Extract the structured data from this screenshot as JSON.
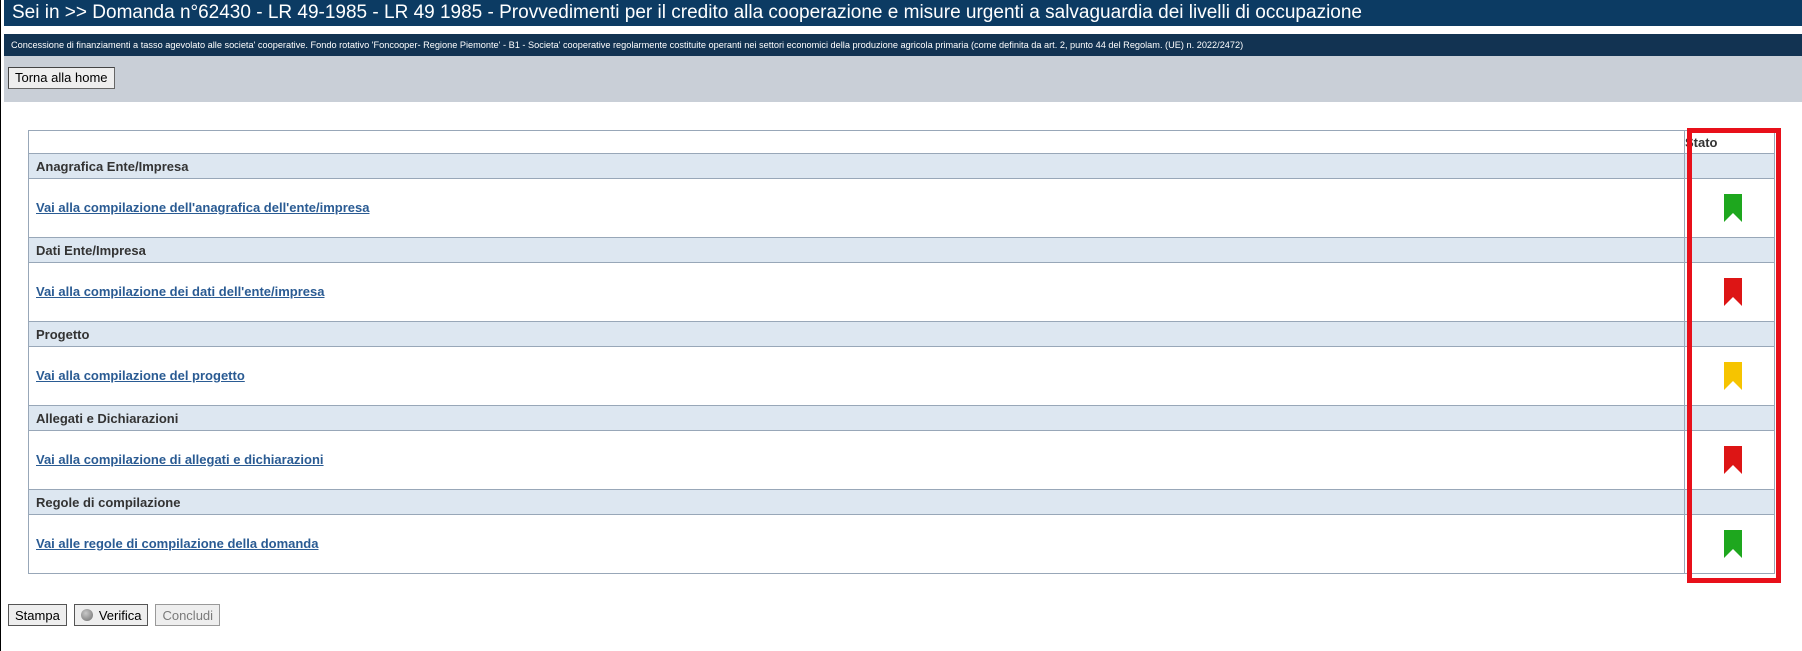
{
  "header": {
    "title": "Sei in >> Domanda n°62430 - LR 49-1985 - LR 49 1985 - Provvedimenti per il credito alla cooperazione e misure urgenti a salvaguardia dei livelli di occupazione",
    "subtitle": "Concessione di finanziamenti a tasso agevolato alle societa' cooperative. Fondo rotativo 'Foncooper- Regione Piemonte' - B1 - Societa' cooperative regolarmente costituite operanti nei settori economici della produzione agricola primaria (come definita da art. 2, punto 44 del Regolam. (UE) n. 2022/2472)"
  },
  "toolbar": {
    "home_label": "Torna alla home"
  },
  "table": {
    "stato_header": "Stato",
    "sections": [
      {
        "title": "Anagrafica Ente/Impresa",
        "link": "Vai alla compilazione dell'anagrafica dell'ente/impresa",
        "status": "green-flag-icon",
        "color": "#1ea71e"
      },
      {
        "title": "Dati Ente/Impresa",
        "link": "Vai alla compilazione dei dati dell'ente/impresa",
        "status": "red-flag-icon",
        "color": "#dd1515"
      },
      {
        "title": "Progetto",
        "link": "Vai alla compilazione del progetto",
        "status": "yellow-flag-icon",
        "color": "#f6c400"
      },
      {
        "title": "Allegati e Dichiarazioni",
        "link": "Vai alla compilazione di allegati e dichiarazioni",
        "status": "red-flag-icon",
        "color": "#dd1515"
      },
      {
        "title": "Regole di compilazione",
        "link": "Vai alle regole di compilazione della domanda",
        "status": "green-flag-icon",
        "color": "#1ea71e"
      }
    ]
  },
  "footer": {
    "print_label": "Stampa",
    "verify_label": "Verifica",
    "conclude_label": "Concludi"
  },
  "colors": {
    "title_bar": "#0c3b63",
    "highlight": "#e8101a"
  }
}
